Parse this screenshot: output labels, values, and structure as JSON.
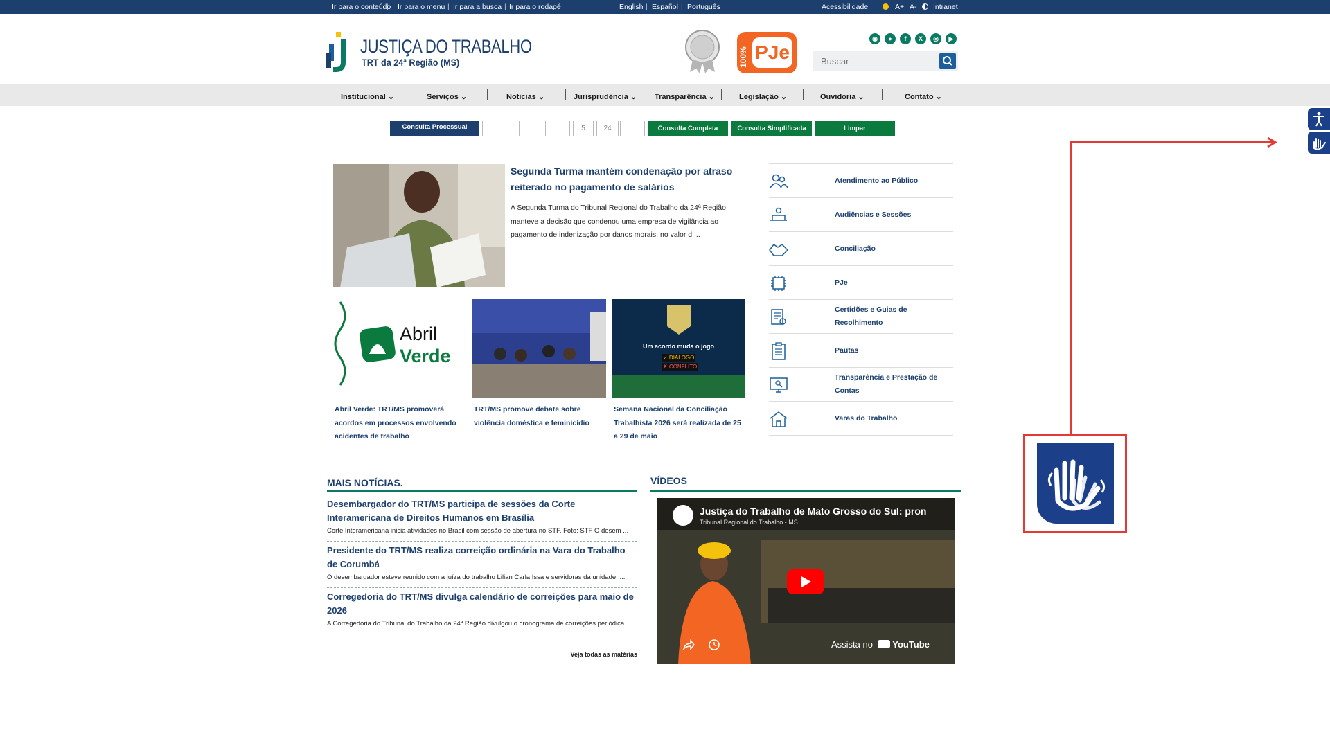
{
  "topbar": {
    "skip_links": [
      "Ir para o conteúdo",
      "Ir para o menu",
      "Ir para a busca",
      "Ir para o rodapé"
    ],
    "languages": [
      "English",
      "Español",
      "Português"
    ],
    "accessibility": "Acessibilidade",
    "font_increase": "A+",
    "font_decrease": "A-",
    "intranet": "Intranet"
  },
  "header": {
    "title": "JUSTIÇA DO TRABALHO",
    "subtitle": "TRT da 24ª Região (MS)",
    "pje_percent": "100%",
    "pje_label": "PJe",
    "search_placeholder": "Buscar",
    "social_icons": [
      "rss-icon",
      "flickr-icon",
      "facebook-icon",
      "x-icon",
      "instagram-icon",
      "youtube-icon"
    ]
  },
  "nav": {
    "items": [
      "Institucional",
      "Serviços",
      "Notícias",
      "Jurisprudência",
      "Transparência",
      "Legislação",
      "Ouvidoria",
      "Contato"
    ]
  },
  "consulta": {
    "label": "Consulta Processual",
    "field_5": "5",
    "field_24": "24",
    "btn_completa": "Consulta Completa",
    "btn_simplificada": "Consulta Simplificada",
    "btn_limpar": "Limpar"
  },
  "featured": {
    "title": "Segunda Turma mantém condenação por atraso reiterado no pagamento de salários",
    "text": "A Segunda Turma do Tribunal Regional do Trabalho da 24ª Região manteve a decisão que condenou uma empresa de vigilância ao pagamento de indenização por danos morais, no valor d ..."
  },
  "cards": [
    {
      "title": "Abril Verde: TRT/MS promoverá acordos em processos envolvendo acidentes de trabalho",
      "img_text_1": "Abril",
      "img_text_2": "Verde"
    },
    {
      "title": "TRT/MS promove debate sobre violência doméstica e feminicídio"
    },
    {
      "title": "Semana Nacional da Conciliação Trabalhista 2026 será realizada de 25 a 29 de maio",
      "img_text_1": "Um acordo muda o jogo",
      "img_text_2": "✓ DIÁLOGO",
      "img_text_3": "✗ CONFLITO"
    }
  ],
  "services": [
    {
      "label": "Atendimento ao Público",
      "icon": "people-icon"
    },
    {
      "label": "Audiências e Sessões",
      "icon": "hearing-icon"
    },
    {
      "label": "Conciliação",
      "icon": "handshake-icon"
    },
    {
      "label": "PJe",
      "icon": "chip-icon"
    },
    {
      "label": "Certidões e Guias de Recolhimento",
      "icon": "certificate-icon"
    },
    {
      "label": "Pautas",
      "icon": "clipboard-icon"
    },
    {
      "label": "Transparência e Prestação de Contas",
      "icon": "monitor-search-icon"
    },
    {
      "label": "Varas do Trabalho",
      "icon": "building-icon"
    }
  ],
  "mais_noticias": {
    "heading": "MAIS NOTÍCIAS.",
    "items": [
      {
        "title": "Desembargador do TRT/MS participa de sessões da Corte Interamericana de Direitos Humanos em Brasília",
        "desc": "Corte Interamericana inicia atividades no Brasil com sessão de abertura no STF. Foto: STF O desem ..."
      },
      {
        "title": "Presidente do TRT/MS realiza correição ordinária na Vara do Trabalho de Corumbá",
        "desc": "O desembargador esteve reunido com a juíza do trabalho Lilian Carla Issa e servidoras da unidade. ..."
      },
      {
        "title": "Corregedoria do TRT/MS divulga calendário de correições para maio de 2026",
        "desc": "A Corregedoria do Tribunal do Trabalho da 24ª Região divulgou o cronograma de correições periódica ..."
      }
    ],
    "see_all": "Veja todas as matérias"
  },
  "videos": {
    "heading": "VÍDEOS",
    "title": "Justiça do Trabalho de Mato Grosso do Sul: pron",
    "channel": "Tribunal Regional do Trabalho - MS",
    "watch_on": "Assista no",
    "brand": "YouTube"
  },
  "colors": {
    "navy": "#1c3f6e",
    "green": "#0a7a3f",
    "teal": "#0a7a63",
    "orange": "#f26522",
    "highlight_red": "#e53935",
    "widget_blue": "#1c3f8a"
  }
}
